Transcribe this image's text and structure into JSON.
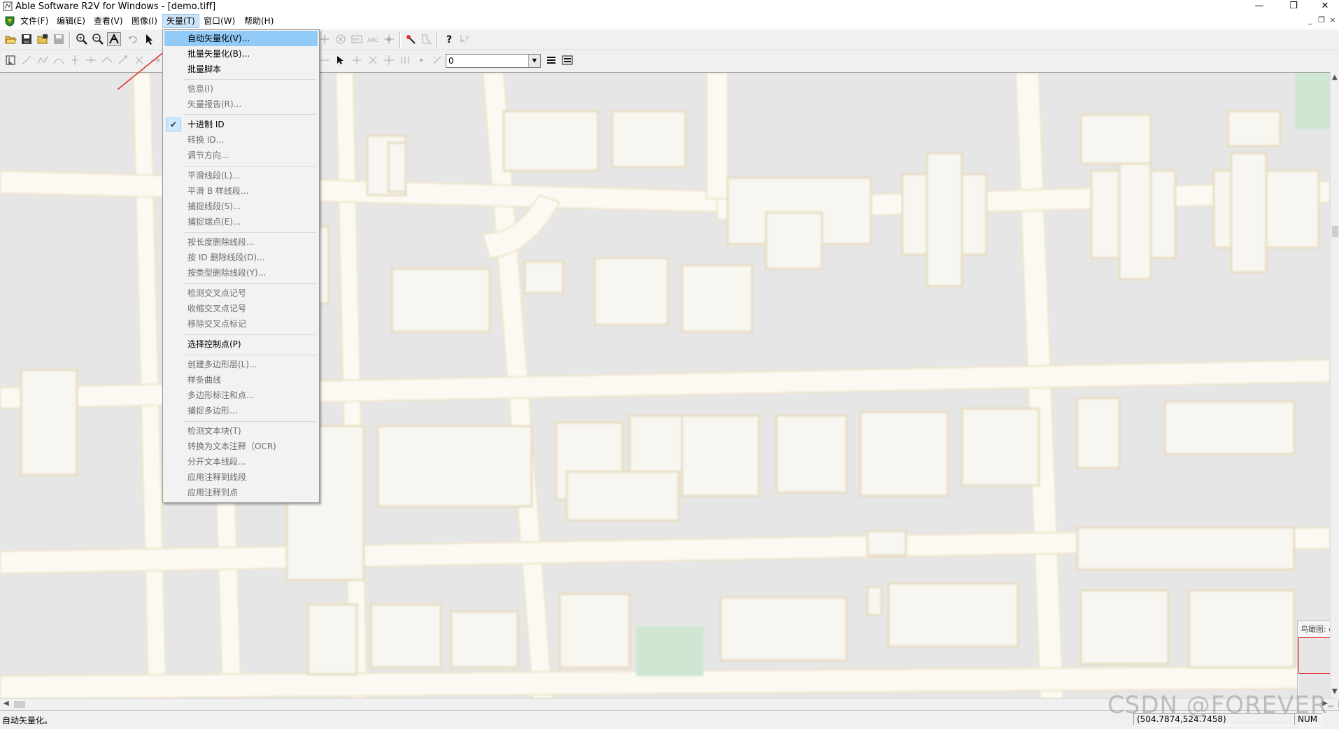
{
  "window": {
    "title": "Able Software R2V for Windows - [demo.tiff]",
    "controls": {
      "minimize": "—",
      "restore": "❐",
      "close": "✕"
    },
    "mdi_controls": {
      "minimize": "_",
      "restore": "❐",
      "close": "×"
    }
  },
  "menubar": {
    "items": [
      {
        "label": "文件(F)"
      },
      {
        "label": "编辑(E)"
      },
      {
        "label": "查看(V)"
      },
      {
        "label": "图像(I)"
      },
      {
        "label": "矢量(T)"
      },
      {
        "label": "窗口(W)"
      },
      {
        "label": "帮助(H)"
      }
    ]
  },
  "toolbar": {
    "id_combo_value": "0"
  },
  "vector_menu": {
    "items": [
      {
        "label": "自动矢量化(V)...",
        "enabled": true,
        "highlighted": true
      },
      {
        "label": "批量矢量化(B)...",
        "enabled": true
      },
      {
        "label": "批量脚本",
        "enabled": true
      },
      {
        "label": "信息(I)",
        "enabled": false
      },
      {
        "label": "矢量报告(R)...",
        "enabled": false
      },
      {
        "label": "十进制 ID",
        "enabled": true,
        "checked": true
      },
      {
        "label": "转换 ID...",
        "enabled": false
      },
      {
        "label": "调节方向...",
        "enabled": false
      },
      {
        "label": "平滑线段(L)...",
        "enabled": false
      },
      {
        "label": "平滑 B 样线段...",
        "enabled": false
      },
      {
        "label": "捕捉线段(S)...",
        "enabled": false
      },
      {
        "label": "捕捉端点(E)...",
        "enabled": false
      },
      {
        "label": "按长度删除线段...",
        "enabled": false
      },
      {
        "label": "按 ID 删除线段(D)...",
        "enabled": false
      },
      {
        "label": "按类型删除线段(Y)...",
        "enabled": false
      },
      {
        "label": "检测交叉点记号",
        "enabled": false
      },
      {
        "label": "收缩交叉点记号",
        "enabled": false
      },
      {
        "label": "移除交叉点标记",
        "enabled": false
      },
      {
        "label": "选择控制点(P)",
        "enabled": true
      },
      {
        "label": "创建多边形层(L)...",
        "enabled": false
      },
      {
        "label": "样条曲线",
        "enabled": false
      },
      {
        "label": "多边形标注和点...",
        "enabled": false
      },
      {
        "label": "捕捉多边形...",
        "enabled": false
      },
      {
        "label": "检测文本块(T)",
        "enabled": false
      },
      {
        "label": "转换为文本注释（OCR)",
        "enabled": false
      },
      {
        "label": "分开文本线段...",
        "enabled": false
      },
      {
        "label": "应用注释到线段",
        "enabled": false
      },
      {
        "label": "应用注释到点",
        "enabled": false
      }
    ]
  },
  "overview": {
    "title": "鸟瞰图: de"
  },
  "statusbar": {
    "message": "自动矢量化。",
    "coordinates": "(504.7874,524.7458)",
    "num": "NUM"
  },
  "watermark": "CSDN @FOREVER-Q",
  "colors": {
    "map_block": "#e6e6e6",
    "map_road": "#fbf9f2",
    "map_building": "#f7f6f0",
    "map_building_edge": "#e8dcc0",
    "map_park": "#cfe6d2",
    "menu_highlight": "#91c9f7",
    "annotation_arrow": "#e03030"
  }
}
